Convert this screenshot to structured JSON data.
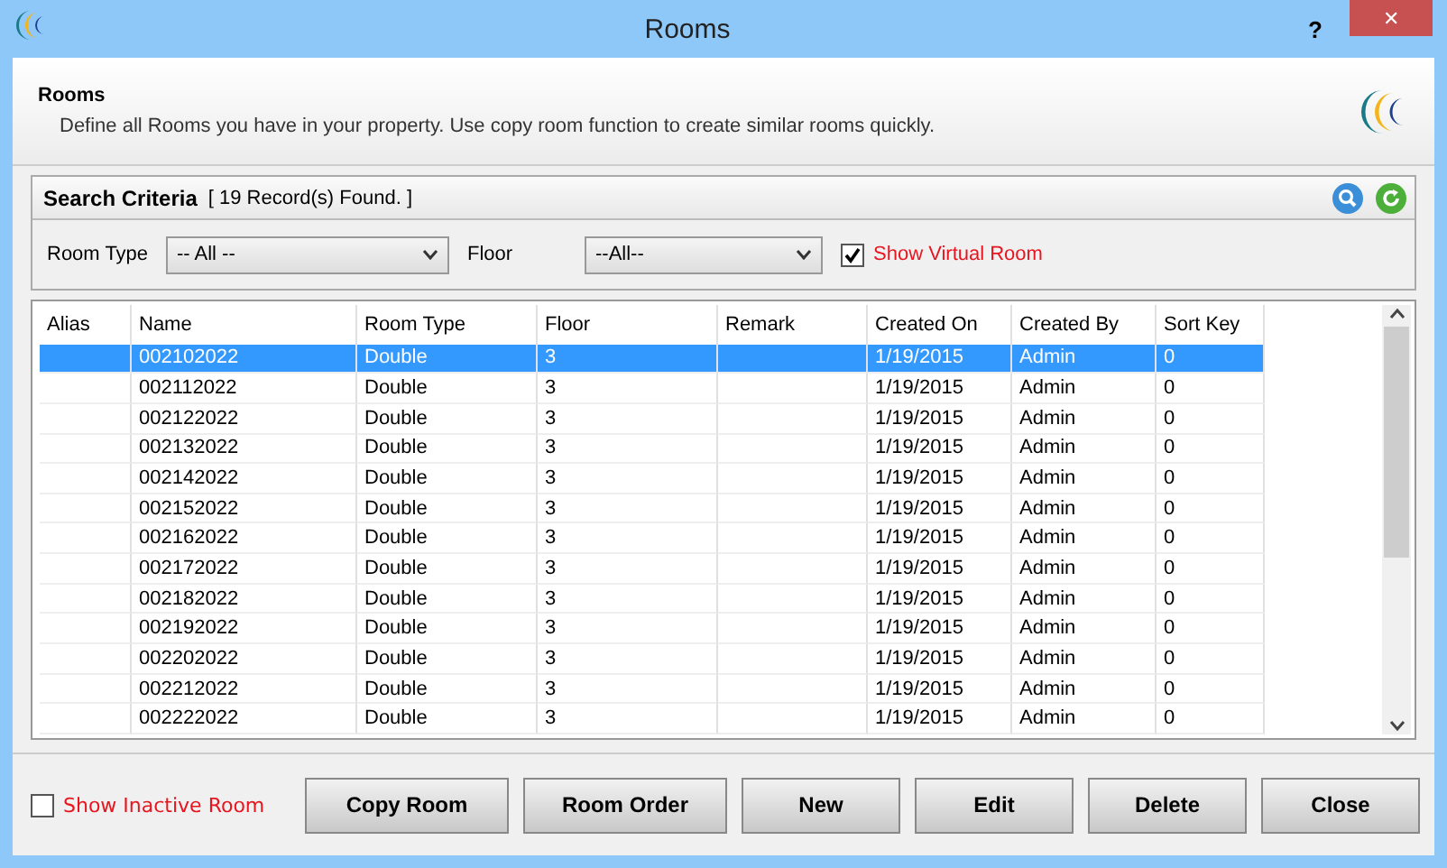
{
  "window": {
    "title": "Rooms",
    "help": "?",
    "close": "✕"
  },
  "header": {
    "title": "Rooms",
    "description": "Define all Rooms you have in your property. Use copy room function to create similar rooms quickly."
  },
  "search": {
    "title": "Search Criteria",
    "count": "[ 19 Record(s) Found. ]",
    "room_type_label": "Room Type",
    "room_type_value": "-- All --",
    "floor_label": "Floor",
    "floor_value": "--All--",
    "show_virtual": {
      "label": "Show Virtual Room",
      "checked": true
    }
  },
  "table": {
    "columns": [
      "Alias",
      "Name",
      "Room Type",
      "Floor",
      "Remark",
      "Created On",
      "Created By",
      "Sort Key"
    ],
    "rows": [
      {
        "cells": [
          "",
          "002102022",
          "Double",
          "3",
          "",
          "1/19/2015",
          "Admin",
          "0"
        ],
        "selected": true
      },
      {
        "cells": [
          "",
          "002112022",
          "Double",
          "3",
          "",
          "1/19/2015",
          "Admin",
          "0"
        ],
        "selected": false
      },
      {
        "cells": [
          "",
          "002122022",
          "Double",
          "3",
          "",
          "1/19/2015",
          "Admin",
          "0"
        ],
        "selected": false
      },
      {
        "cells": [
          "",
          "002132022",
          "Double",
          "3",
          "",
          "1/19/2015",
          "Admin",
          "0"
        ],
        "selected": false
      },
      {
        "cells": [
          "",
          "002142022",
          "Double",
          "3",
          "",
          "1/19/2015",
          "Admin",
          "0"
        ],
        "selected": false
      },
      {
        "cells": [
          "",
          "002152022",
          "Double",
          "3",
          "",
          "1/19/2015",
          "Admin",
          "0"
        ],
        "selected": false
      },
      {
        "cells": [
          "",
          "002162022",
          "Double",
          "3",
          "",
          "1/19/2015",
          "Admin",
          "0"
        ],
        "selected": false
      },
      {
        "cells": [
          "",
          "002172022",
          "Double",
          "3",
          "",
          "1/19/2015",
          "Admin",
          "0"
        ],
        "selected": false
      },
      {
        "cells": [
          "",
          "002182022",
          "Double",
          "3",
          "",
          "1/19/2015",
          "Admin",
          "0"
        ],
        "selected": false
      },
      {
        "cells": [
          "",
          "002192022",
          "Double",
          "3",
          "",
          "1/19/2015",
          "Admin",
          "0"
        ],
        "selected": false
      },
      {
        "cells": [
          "",
          "002202022",
          "Double",
          "3",
          "",
          "1/19/2015",
          "Admin",
          "0"
        ],
        "selected": false
      },
      {
        "cells": [
          "",
          "002212022",
          "Double",
          "3",
          "",
          "1/19/2015",
          "Admin",
          "0"
        ],
        "selected": false
      },
      {
        "cells": [
          "",
          "002222022",
          "Double",
          "3",
          "",
          "1/19/2015",
          "Admin",
          "0"
        ],
        "selected": false
      }
    ]
  },
  "footer": {
    "show_inactive": {
      "label": "Show Inactive Room",
      "checked": false
    },
    "buttons": [
      "Copy Room",
      "Room Order",
      "New",
      "Edit",
      "Delete",
      "Close"
    ]
  }
}
